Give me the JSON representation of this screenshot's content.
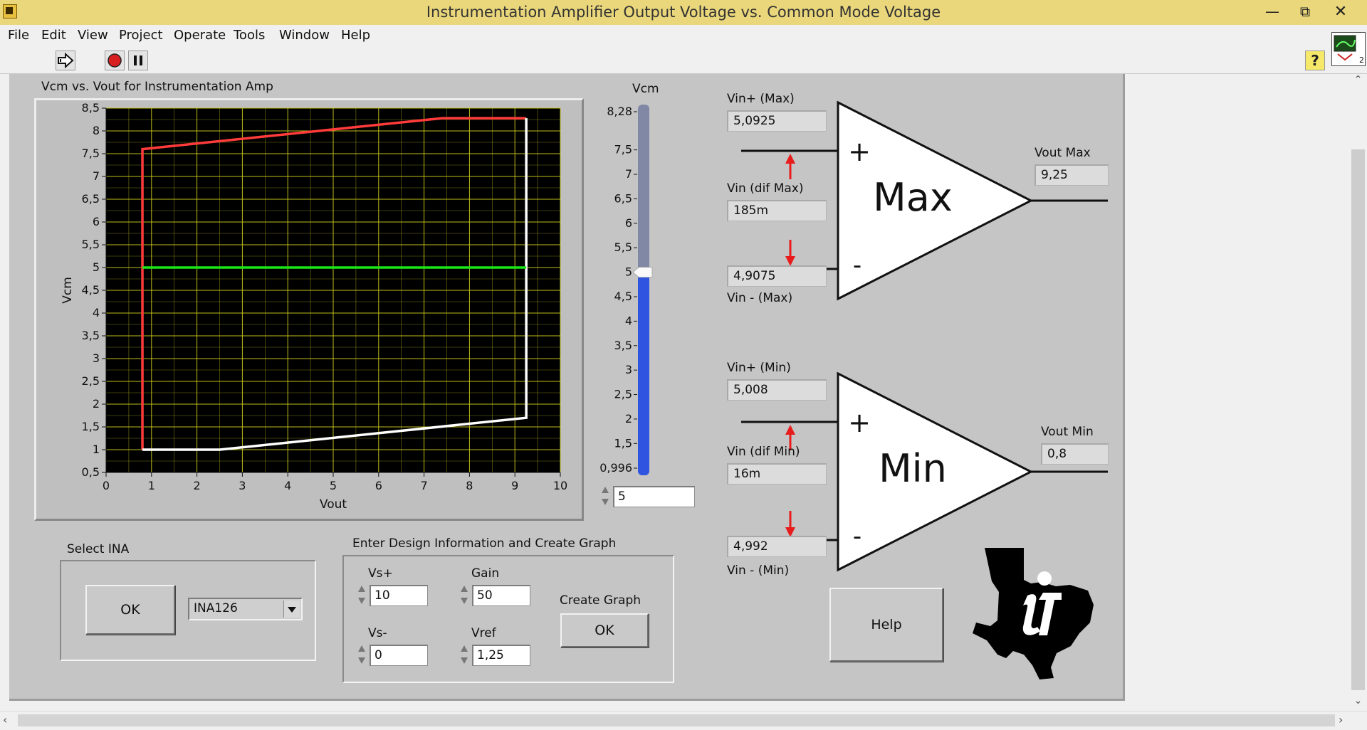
{
  "window": {
    "title": "Instrumentation Amplifier Output Voltage vs. Common Mode Voltage"
  },
  "menu": [
    "File",
    "Edit",
    "View",
    "Project",
    "Operate",
    "Tools",
    "Window",
    "Help"
  ],
  "toolbar_icons": [
    "run-arrow-icon",
    "abort-stop-icon",
    "pause-icon",
    "context-help-icon"
  ],
  "chart": {
    "title": "Vcm vs. Vout for Instrumentation Amp",
    "xlabel": "Vout",
    "ylabel": "Vcm",
    "xticks": [
      "0",
      "1",
      "2",
      "3",
      "4",
      "5",
      "6",
      "7",
      "8",
      "9",
      "10"
    ],
    "yticks": [
      "0,5",
      "1",
      "1,5",
      "2",
      "2,5",
      "3",
      "3,5",
      "4",
      "4,5",
      "5",
      "5,5",
      "6",
      "6,5",
      "7",
      "7,5",
      "8",
      "8,5"
    ]
  },
  "chart_data": {
    "type": "line",
    "title": "Vcm vs. Vout for Instrumentation Amp",
    "xlabel": "Vout",
    "ylabel": "Vcm",
    "xlim": [
      0,
      10
    ],
    "ylim": [
      0.5,
      8.5
    ],
    "grid": true,
    "background": "#000000",
    "series": [
      {
        "color": "#ff3b3b",
        "x": [
          0.8,
          0.8,
          7.4,
          9.25
        ],
        "y": [
          1.0,
          7.6,
          8.28,
          8.28
        ]
      },
      {
        "color": "#ffffff",
        "x": [
          0.8,
          1.7,
          2.5,
          9.25,
          9.25
        ],
        "y": [
          1.0,
          1.0,
          1.0,
          1.7,
          8.28
        ]
      },
      {
        "color": "#19e619",
        "x": [
          0.8,
          9.25
        ],
        "y": [
          5.0,
          5.0
        ]
      }
    ]
  },
  "vcm_slider": {
    "label": "Vcm",
    "ticks": [
      "8,28",
      "7,5",
      "7",
      "6,5",
      "6",
      "5,5",
      "5",
      "4,5",
      "4",
      "3,5",
      "3",
      "2,5",
      "2",
      "1,5",
      "0,996"
    ],
    "min": 0.996,
    "max": 8.28,
    "value": 5,
    "value_text": "5"
  },
  "amp_max": {
    "name": "Max",
    "vin_plus_label": "Vin+ (Max)",
    "vin_plus": "5,0925",
    "vin_dif_label": "Vin (dif Max)",
    "vin_dif": "185m",
    "vin_minus_label": "Vin - (Max)",
    "vin_minus": "4,9075",
    "vout_label": "Vout Max",
    "vout": "9,25",
    "plus_sign": "+",
    "minus_sign": "-"
  },
  "amp_min": {
    "name": "Min",
    "vin_plus_label": "Vin+ (Min)",
    "vin_plus": "5,008",
    "vin_dif_label": "Vin (dif Min)",
    "vin_dif": "16m",
    "vin_minus_label": "Vin - (Min)",
    "vin_minus": "4,992",
    "vout_label": "Vout Min",
    "vout": "0,8",
    "plus_sign": "+",
    "minus_sign": "-"
  },
  "select_ina": {
    "label": "Select INA",
    "ok": "OK",
    "selected": "INA126"
  },
  "design": {
    "label": "Enter Design Information and Create Graph",
    "vs_plus_label": "Vs+",
    "vs_plus": "10",
    "gain_label": "Gain",
    "gain": "50",
    "vs_minus_label": "Vs-",
    "vs_minus": "0",
    "vref_label": "Vref",
    "vref": "1,25",
    "create_graph_label": "Create Graph",
    "create_ok": "OK"
  },
  "help_button": "Help",
  "colors": {
    "titlebar": "#ead77b",
    "panel": "#c5c5c5",
    "slider_fill": "#2f55e0",
    "arrow": "#e81c1c"
  }
}
